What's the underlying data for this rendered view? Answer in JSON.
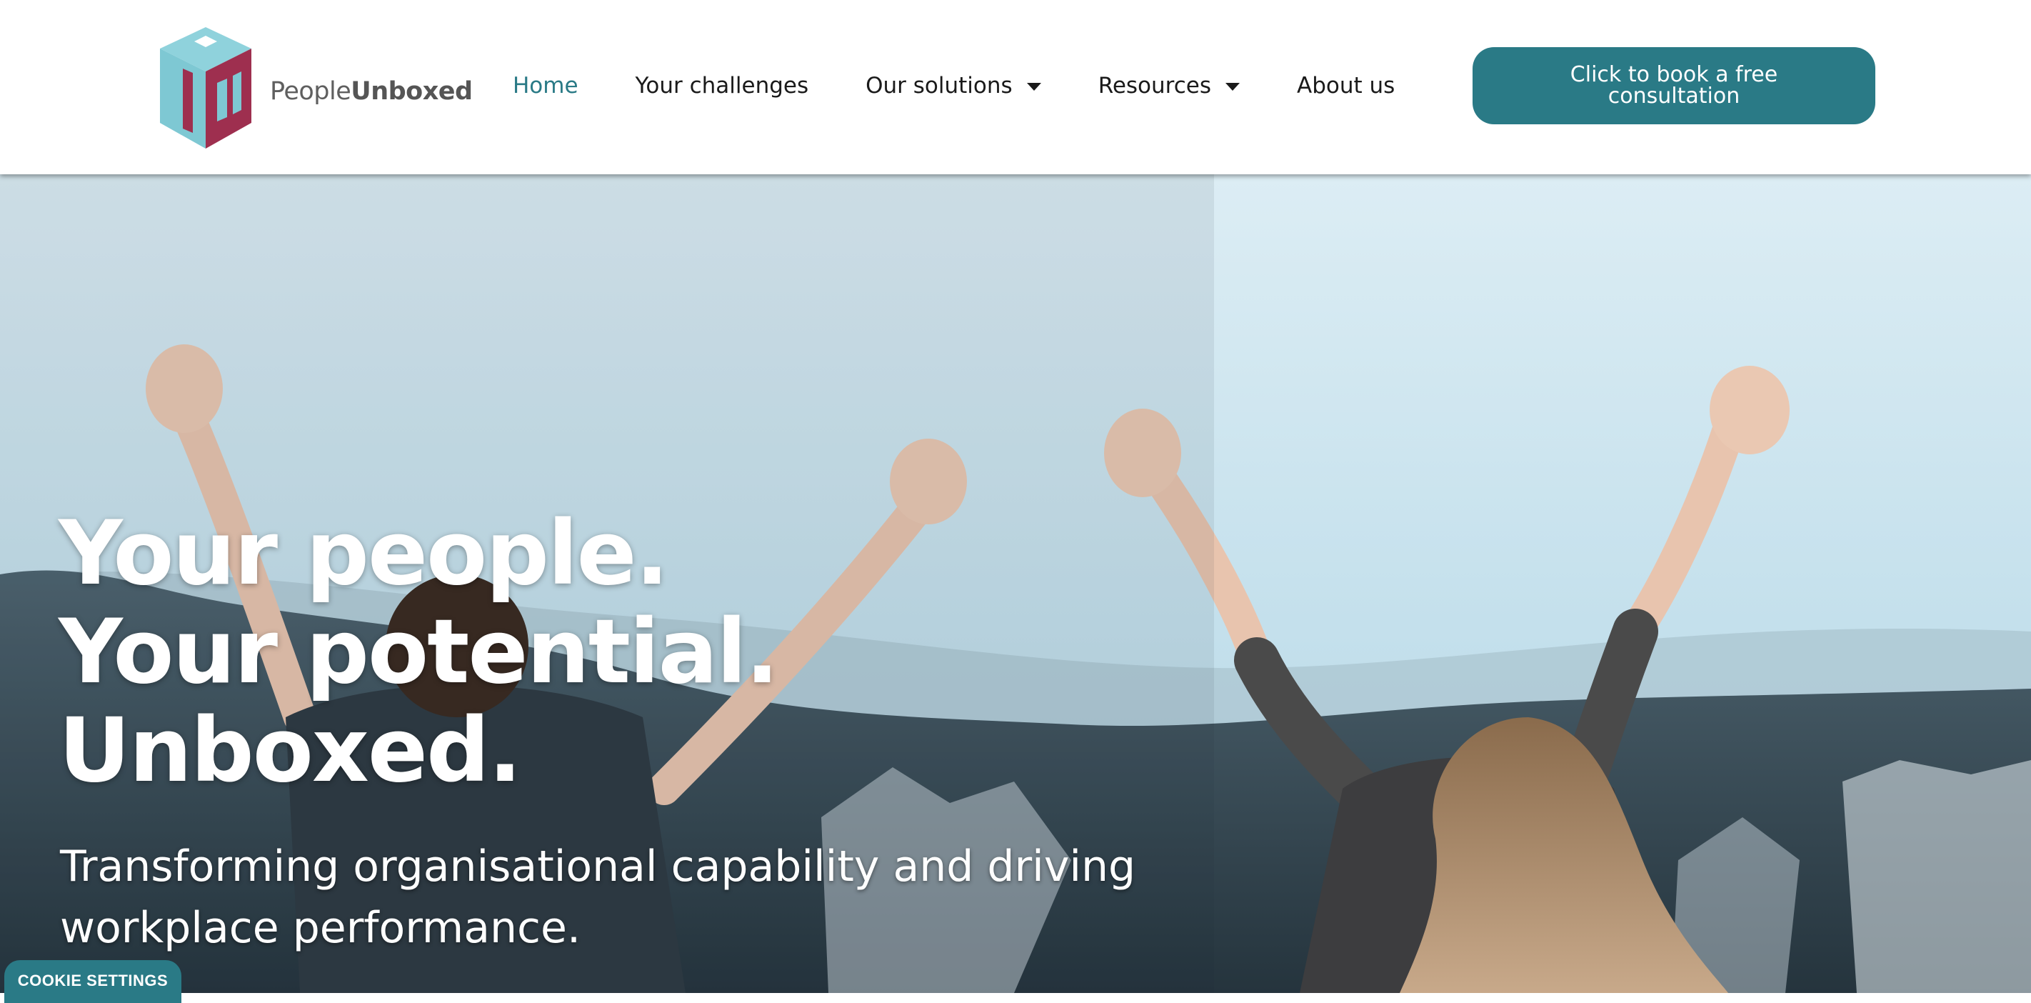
{
  "brand": {
    "name_light": "People",
    "name_bold": "Unboxed",
    "logo_icon": "cube-pu-logo-icon",
    "colors": {
      "teal": "#2a7a86",
      "cube_light": "#7ec8d3",
      "cube_dark": "#9e2f4f"
    }
  },
  "nav": {
    "items": [
      {
        "label": "Home",
        "active": true,
        "has_dropdown": false
      },
      {
        "label": "Your challenges",
        "active": false,
        "has_dropdown": false
      },
      {
        "label": "Our solutions",
        "active": false,
        "has_dropdown": true
      },
      {
        "label": "Resources",
        "active": false,
        "has_dropdown": true
      },
      {
        "label": "About us",
        "active": false,
        "has_dropdown": false
      }
    ],
    "dropdown_icon": "caret-down-icon"
  },
  "cta": {
    "label": "Click to book a free consultation"
  },
  "hero": {
    "headline": [
      "Your people.",
      "Your potential.",
      "Unboxed."
    ],
    "subheadline": "Transforming organisational capability and driving workplace performance."
  },
  "cookie": {
    "label": "COOKIE SETTINGS"
  }
}
